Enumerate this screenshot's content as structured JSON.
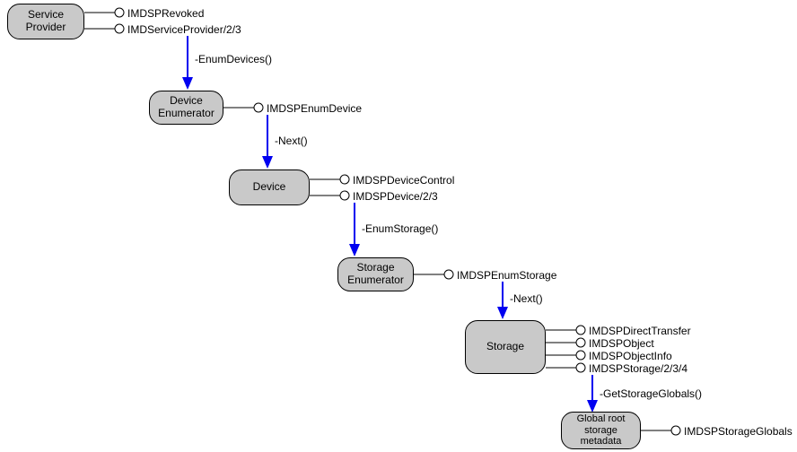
{
  "nodes": {
    "service_provider": "Service\nProvider",
    "device_enumerator": "Device\nEnumerator",
    "device": "Device",
    "storage_enumerator": "Storage\nEnumerator",
    "storage": "Storage",
    "global_root": "Global root\nstorage\nmetadata"
  },
  "interfaces": {
    "sp_revoked": "IMDSPRevoked",
    "sp_provider": "IMDServiceProvider/2/3",
    "enum_device": "IMDSPEnumDevice",
    "device_control": "IMDSPDeviceControl",
    "device_iface": "IMDSPDevice/2/3",
    "enum_storage": "IMDSPEnumStorage",
    "direct_transfer": "IMDSPDirectTransfer",
    "object": "IMDSPObject",
    "object_info": "IMDSPObjectInfo",
    "storage_iface": "IMDSPStorage/2/3/4",
    "storage_globals": "IMDSPStorageGlobals"
  },
  "calls": {
    "enum_devices": "-EnumDevices()",
    "next1": "-Next()",
    "enum_storage": "-EnumStorage()",
    "next2": "-Next()",
    "get_storage_globals": "-GetStorageGlobals()"
  }
}
